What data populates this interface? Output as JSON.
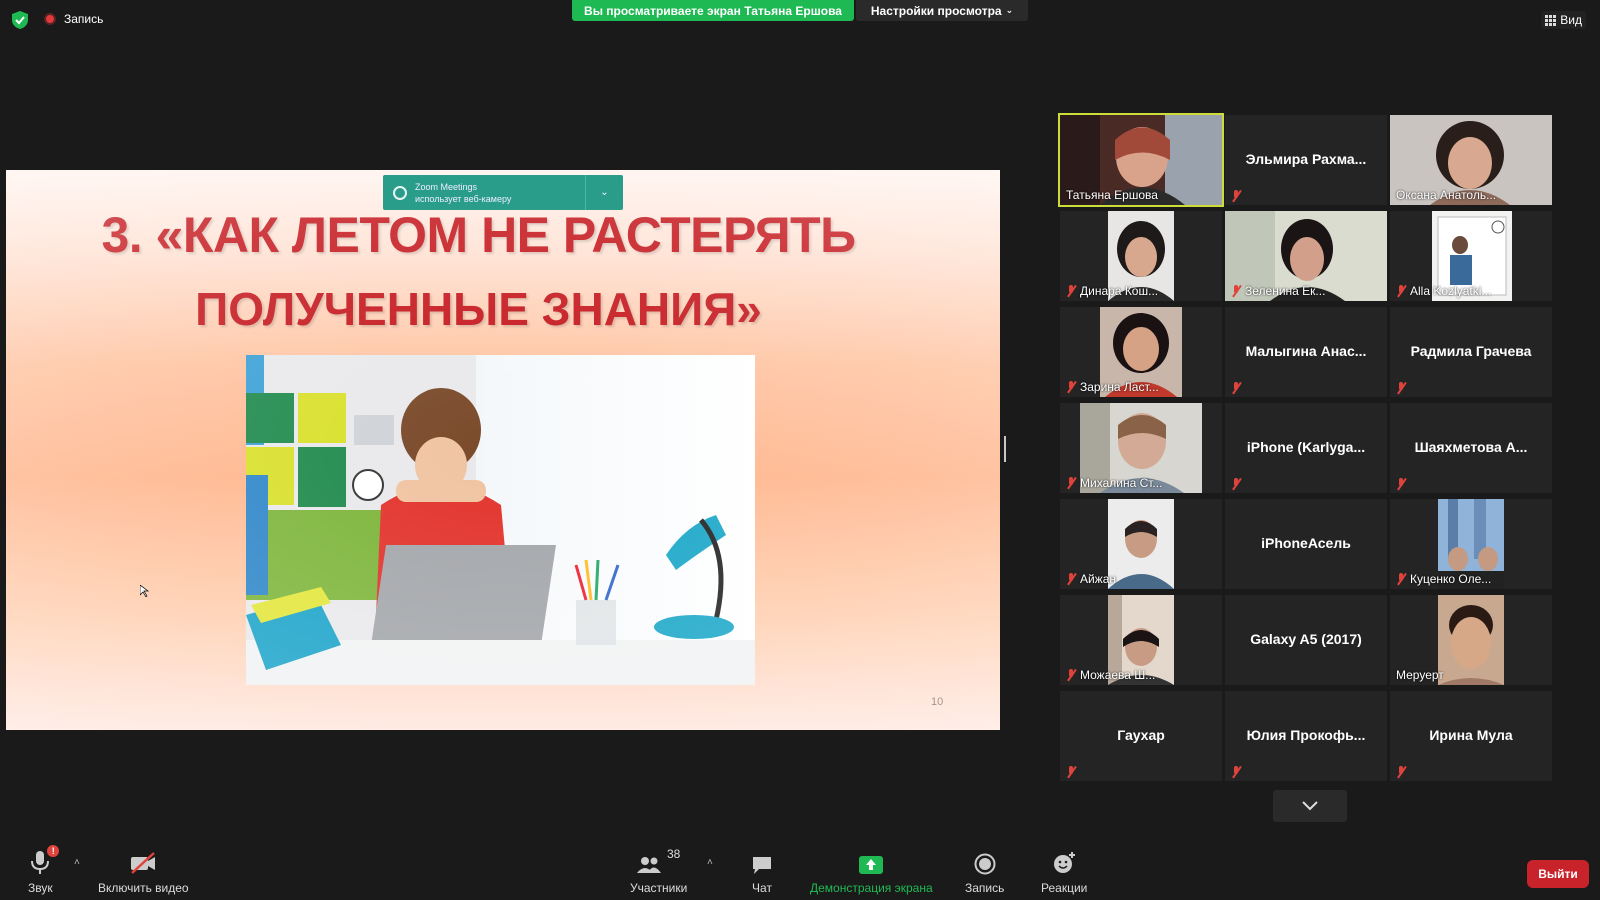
{
  "top_bar": {
    "recording_label": "Запись",
    "viewing_banner": "Вы просматриваете экран Татьяна Ершова",
    "view_settings": "Настройки просмотра",
    "view_button": "Вид"
  },
  "slide": {
    "notification_title": "Zoom Meetings",
    "notification_sub": "использует веб-камеру",
    "title_line1": "3. «КАК ЛЕТОМ НЕ РАСТЕРЯТЬ",
    "title_line2": "ПОЛУЧЕННЫЕ ЗНАНИЯ»",
    "page_number": "10"
  },
  "participants": [
    {
      "name": "Татьяна Ершова",
      "video": true,
      "active": true,
      "muted": false
    },
    {
      "name": "Эльмира  Рахма...",
      "video": false,
      "muted": true
    },
    {
      "name": "Оксана Анатоль...",
      "video": true,
      "muted": false
    },
    {
      "name": "Динара Кош...",
      "video": true,
      "muted": true
    },
    {
      "name": "Зеленина Ек...",
      "video": true,
      "muted": true
    },
    {
      "name": "Alla Kozlyatki...",
      "video": true,
      "muted": true
    },
    {
      "name": "Зарина Ласт...",
      "video": true,
      "muted": true
    },
    {
      "name": "Малыгина  Анас...",
      "video": false,
      "muted": true
    },
    {
      "name": "Радмила Грачева",
      "video": false,
      "muted": true
    },
    {
      "name": "Михалина Ст...",
      "video": true,
      "muted": true
    },
    {
      "name": "iPhone  (Karlyga...",
      "video": false,
      "muted": true
    },
    {
      "name": "Шаяхметова  А...",
      "video": false,
      "muted": true
    },
    {
      "name": "Айжан",
      "video": true,
      "muted": true
    },
    {
      "name": "iPhoneАсель",
      "video": false,
      "muted": false
    },
    {
      "name": "Куценко Оле...",
      "video": true,
      "muted": true
    },
    {
      "name": "Можаева Ш...",
      "video": true,
      "muted": true
    },
    {
      "name": "Galaxy A5 (2017)",
      "video": false,
      "muted": false
    },
    {
      "name": "Меруерт",
      "video": true,
      "muted": false
    },
    {
      "name": "Гаухар",
      "video": false,
      "muted": true
    },
    {
      "name": "Юлия  Прокофь...",
      "video": false,
      "muted": true
    },
    {
      "name": "Ирина Мула",
      "video": false,
      "muted": true
    }
  ],
  "toolbar": {
    "audio_label": "Звук",
    "audio_alert": "!",
    "video_label": "Включить видео",
    "participants_label": "Участники",
    "participants_count": "38",
    "chat_label": "Чат",
    "share_label": "Демонстрация экрана",
    "record_label": "Запись",
    "reactions_label": "Реакции",
    "leave_label": "Выйти"
  },
  "colors": {
    "share_green": "#1fb954",
    "active_speaker": "#cddc39",
    "leave_red": "#c8222a",
    "title_red": "#c4161c"
  }
}
